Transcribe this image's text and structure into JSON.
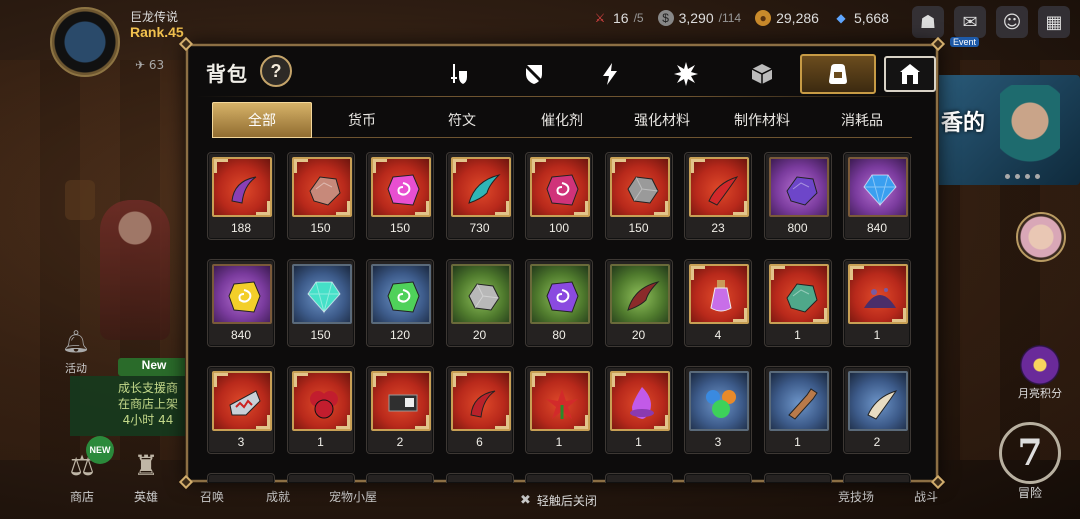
{
  "player": {
    "name": "巨龙传说",
    "rank": "Rank.45",
    "level_badge": "63"
  },
  "resources": [
    {
      "icon": "crossed-swords-icon",
      "value": "16",
      "max": "/5"
    },
    {
      "icon": "silver-coin-icon",
      "value": "3,290",
      "max": "/114"
    },
    {
      "icon": "gold-coin-icon",
      "value": "29,286",
      "max": ""
    },
    {
      "icon": "gem-icon",
      "value": "5,668",
      "max": ""
    }
  ],
  "top_right": {
    "event_label": "Event"
  },
  "banner_right_text": "香的",
  "side_left": {
    "activity_label": "活动",
    "new_label": "New",
    "growth_line1": "成长支援商",
    "growth_line2": "在商店上架",
    "growth_line3": "4小时 44"
  },
  "side_right": {
    "bonus_label": "月亮积分"
  },
  "bottom_nav": [
    {
      "label": "商店",
      "icon": "scales-icon",
      "badge": "NEW"
    },
    {
      "label": "英雄",
      "icon": "hero-helmet-icon"
    },
    {
      "label": "召唤",
      "icon": "summon-icon"
    },
    {
      "label": "成就",
      "icon": "trophy-icon"
    },
    {
      "label": "宠物小屋",
      "icon": "pet-house-icon"
    },
    {
      "label": "竞技场",
      "icon": "arena-icon"
    },
    {
      "label": "战斗",
      "icon": "battle-icon"
    }
  ],
  "adventure": {
    "label": "冒险",
    "glyph": "7"
  },
  "close_hint": "轻触后关闭",
  "bag": {
    "title": "背包",
    "help_glyph": "?",
    "categories": [
      {
        "icon": "sword-shield-icon",
        "active": false
      },
      {
        "icon": "broken-shield-icon",
        "active": false
      },
      {
        "icon": "lightning-icon",
        "active": false
      },
      {
        "icon": "starburst-hand-icon",
        "active": false
      },
      {
        "icon": "dice-box-icon",
        "active": false
      },
      {
        "icon": "backpack-icon",
        "active": true
      },
      {
        "icon": "house-icon",
        "active": false
      }
    ],
    "tabs": [
      "全部",
      "货币",
      "符文",
      "催化剂",
      "强化材料",
      "制作材料",
      "消耗品"
    ],
    "active_tab": "全部",
    "items": [
      {
        "name": "purple-dragon-horn",
        "bg": "red",
        "color": "#8a3fb4",
        "shape": "horn",
        "qty": "188"
      },
      {
        "name": "bronze-dragon-scale",
        "bg": "red",
        "color": "#c7897a",
        "shape": "scale",
        "qty": "150"
      },
      {
        "name": "pink-spiral-rune",
        "bg": "red",
        "color": "#e84fd1",
        "shape": "rune",
        "qty": "150"
      },
      {
        "name": "teal-claw",
        "bg": "red",
        "color": "#2fb6b7",
        "shape": "claw",
        "qty": "730"
      },
      {
        "name": "magenta-rune-stone",
        "bg": "red",
        "color": "#d0337a",
        "shape": "rune",
        "qty": "100"
      },
      {
        "name": "iron-ore",
        "bg": "red",
        "color": "#9a9a9a",
        "shape": "ore",
        "qty": "150"
      },
      {
        "name": "red-fang",
        "bg": "red",
        "color": "#d1282a",
        "shape": "fang",
        "qty": "23"
      },
      {
        "name": "violet-dragon-scale",
        "bg": "purple",
        "color": "#6d46c9",
        "shape": "scale",
        "qty": "800"
      },
      {
        "name": "blue-crystal",
        "bg": "purple",
        "color": "#3a9ff0",
        "shape": "crystal",
        "qty": "840"
      },
      {
        "name": "golden-rune",
        "bg": "purple",
        "color": "#f3cf2a",
        "shape": "rune",
        "qty": "840"
      },
      {
        "name": "cyan-crystal",
        "bg": "blue",
        "color": "#45e0c8",
        "shape": "crystal",
        "qty": "150"
      },
      {
        "name": "green-spiral-rune",
        "bg": "blue",
        "color": "#4fd15a",
        "shape": "rune",
        "qty": "120"
      },
      {
        "name": "silver-ore",
        "bg": "green",
        "color": "#b8b8b8",
        "shape": "ore",
        "qty": "20"
      },
      {
        "name": "violet-rune-stone",
        "bg": "green",
        "color": "#8a4ae0",
        "shape": "rune",
        "qty": "80"
      },
      {
        "name": "beast-claw",
        "bg": "green",
        "color": "#8b2a2a",
        "shape": "claw",
        "qty": "20"
      },
      {
        "name": "mana-potion",
        "bg": "red",
        "color": "#c86ee8",
        "shape": "potion",
        "qty": "4"
      },
      {
        "name": "jade-armor-piece",
        "bg": "red",
        "color": "#4fa88a",
        "shape": "scale",
        "qty": "1"
      },
      {
        "name": "dark-powder",
        "bg": "red",
        "color": "#4a2e6a",
        "shape": "powder",
        "qty": "1"
      },
      {
        "name": "red-dragon-jaw",
        "bg": "red",
        "color": "#c9d0d8",
        "shape": "jaw",
        "qty": "3"
      },
      {
        "name": "crimson-scales",
        "bg": "red",
        "color": "#c21d2e",
        "shape": "cluster",
        "qty": "1"
      },
      {
        "name": "circuit-chip",
        "bg": "red",
        "color": "#2f2f2f",
        "shape": "chip",
        "qty": "2"
      },
      {
        "name": "red-twisted-horn",
        "bg": "red",
        "color": "#b9212a",
        "shape": "horn",
        "qty": "6"
      },
      {
        "name": "red-flower",
        "bg": "red",
        "color": "#d22a2a",
        "shape": "flower",
        "qty": "1"
      },
      {
        "name": "purple-flame",
        "bg": "red",
        "color": "#c25ae8",
        "shape": "flame",
        "qty": "1"
      },
      {
        "name": "color-orbs",
        "bg": "blue",
        "color": "#3dd15a",
        "shape": "orbs",
        "qty": "3"
      },
      {
        "name": "bronze-wrench",
        "bg": "blue",
        "color": "#b97a4a",
        "shape": "wrench",
        "qty": "1"
      },
      {
        "name": "ivory-fang",
        "bg": "blue",
        "color": "#e8dcc2",
        "shape": "fang",
        "qty": "2"
      }
    ]
  }
}
